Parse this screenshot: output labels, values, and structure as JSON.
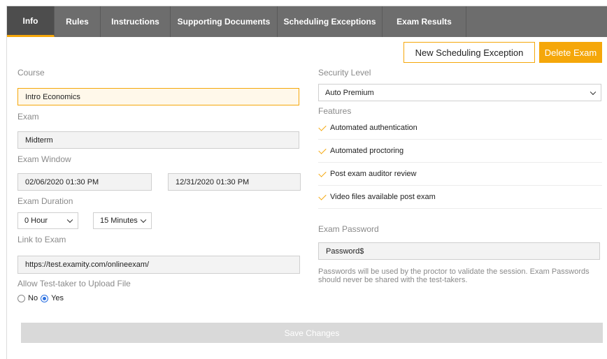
{
  "tabs": [
    "Info",
    "Rules",
    "Instructions",
    "Supporting Documents",
    "Scheduling Exceptions",
    "Exam Results"
  ],
  "actions": {
    "new_exception": "New Scheduling Exception",
    "delete_exam": "Delete Exam",
    "save": "Save Changes"
  },
  "form": {
    "course_label": "Course",
    "course_value": "Intro Economics",
    "exam_label": "Exam",
    "exam_value": "Midterm",
    "window_label": "Exam Window",
    "window_start": "02/06/2020 01:30 PM",
    "window_end": "12/31/2020 01:30 PM",
    "duration_label": "Exam Duration",
    "duration_hours": "0 Hour",
    "duration_minutes": "15 Minutes",
    "link_label": "Link to Exam",
    "link_value": "https://test.examity.com/onlineexam/",
    "upload_label": "Allow Test-taker to Upload File",
    "upload_no": "No",
    "upload_yes": "Yes",
    "upload_selected": "Yes"
  },
  "right": {
    "security_label": "Security Level",
    "security_value": "Auto Premium",
    "features_label": "Features",
    "features": [
      "Automated authentication",
      "Automated proctoring",
      "Post exam auditor review",
      "Video files available post exam"
    ],
    "password_label": "Exam Password",
    "password_value": "Password$",
    "password_help": "Passwords will be used by the proctor to validate the session. Exam Passwords should never be shared with the test-takers."
  },
  "colors": {
    "accent": "#f5a70a",
    "tabbar": "#6d6d6d",
    "tab_active": "#4d4d4d",
    "radio_selected": "#2a6fe0",
    "disabled_button": "#d9d9d9"
  }
}
